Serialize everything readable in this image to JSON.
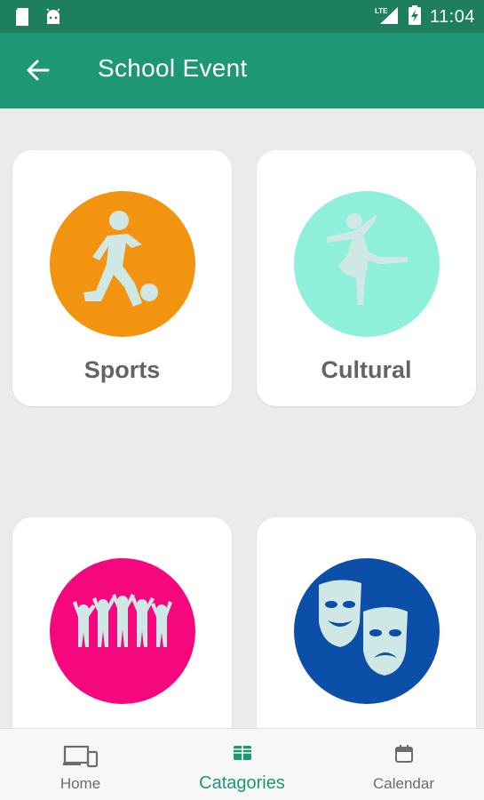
{
  "status_bar": {
    "time": "11:04",
    "network": "LTE"
  },
  "app_bar": {
    "title": "School Event",
    "back_icon": "arrow-back-icon"
  },
  "categories": [
    {
      "label": "Sports",
      "color": "#f29410",
      "icon": "soccer-player-icon"
    },
    {
      "label": "Cultural",
      "color": "#8ef0d9",
      "icon": "ballet-dancer-icon"
    },
    {
      "label": "",
      "color": "#f5077d",
      "icon": "group-people-icon"
    },
    {
      "label": "",
      "color": "#0b4fa8",
      "icon": "drama-masks-icon"
    }
  ],
  "bottom_nav": {
    "items": [
      {
        "label": "Home",
        "icon": "devices-icon",
        "active": false
      },
      {
        "label": "Catagories",
        "icon": "grid-icon",
        "active": true
      },
      {
        "label": "Calendar",
        "icon": "calendar-icon",
        "active": false
      }
    ]
  },
  "colors": {
    "status_bar": "#1e7f5e",
    "app_bar": "#1e9775",
    "background": "#ebebeb",
    "accent": "#1e9775",
    "icon_fill": "#cfe8e6"
  }
}
